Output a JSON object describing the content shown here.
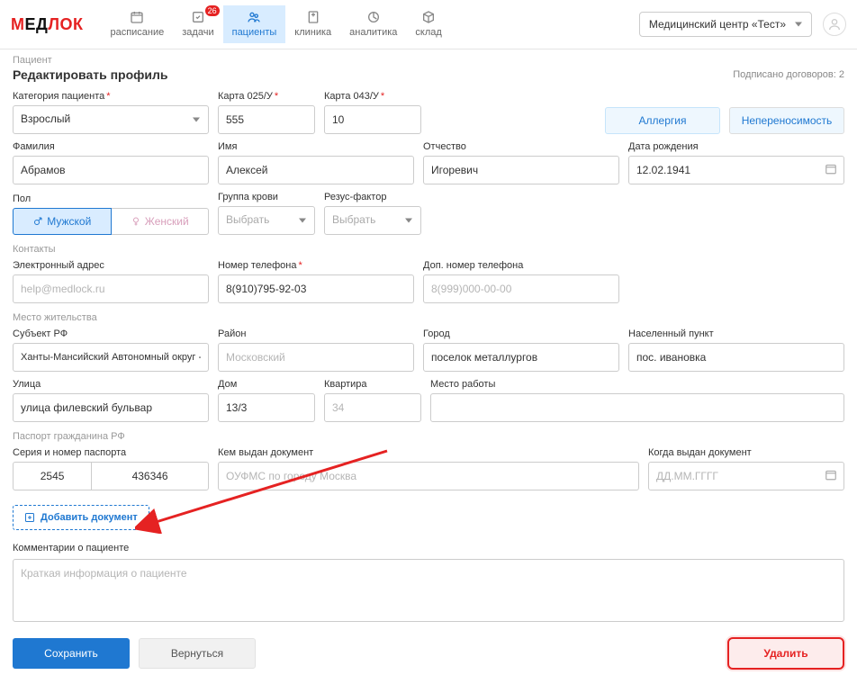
{
  "header": {
    "logo": {
      "part1": "M",
      "part2": "ЕД",
      "part3": "ЛОК"
    },
    "nav": [
      {
        "label": "расписание",
        "icon": "calendar",
        "badge": null
      },
      {
        "label": "задачи",
        "icon": "tasks",
        "badge": "26"
      },
      {
        "label": "пациенты",
        "icon": "patients",
        "badge": null,
        "active": true
      },
      {
        "label": "клиника",
        "icon": "clinic",
        "badge": null
      },
      {
        "label": "аналитика",
        "icon": "analytics",
        "badge": null
      },
      {
        "label": "склад",
        "icon": "warehouse",
        "badge": null
      }
    ],
    "center": "Медицинский центр «Тест»"
  },
  "breadcrumb": "Пациент",
  "title": "Редактировать профиль",
  "signed": "Подписано договоров: 2",
  "buttons": {
    "allergy": "Аллергия",
    "intolerance": "Непереносимость",
    "add_doc": "Добавить документ",
    "save": "Сохранить",
    "back": "Вернуться",
    "delete": "Удалить"
  },
  "labels": {
    "category": "Категория пациента",
    "card025": "Карта 025/У",
    "card043": "Карта 043/У",
    "lastname": "Фамилия",
    "firstname": "Имя",
    "patronymic": "Отчество",
    "birthdate": "Дата рождения",
    "gender": "Пол",
    "blood": "Группа крови",
    "rh": "Резус-фактор",
    "contacts": "Контакты",
    "email": "Электронный адрес",
    "phone": "Номер телефона",
    "phone2": "Доп. номер телефона",
    "residence": "Место жительства",
    "region": "Субъект РФ",
    "district": "Район",
    "city": "Город",
    "settlement": "Населенный пункт",
    "street": "Улица",
    "house": "Дом",
    "apt": "Квартира",
    "work": "Место работы",
    "passport_section": "Паспорт гражданина РФ",
    "passport_sn": "Серия и номер паспорта",
    "passport_issuer": "Кем выдан документ",
    "passport_date": "Когда выдан документ",
    "comments": "Комментарии о пациенте"
  },
  "values": {
    "category": "Взрослый",
    "card025": "555",
    "card043": "10",
    "lastname": "Абрамов",
    "firstname": "Алексей",
    "patronymic": "Игоревич",
    "birthdate": "12.02.1941",
    "gender_male": "Мужской",
    "gender_female": "Женский",
    "blood": "Выбрать",
    "rh": "Выбрать",
    "email_ph": "help@medlock.ru",
    "phone": "8(910)795-92-03",
    "phone2_ph": "8(999)000-00-00",
    "region": "Ханты-Мансийский Автономный округ - Югра",
    "district_ph": "Московский",
    "city": "поселок металлургов",
    "settlement": "пос. ивановка",
    "street": "улица филевский бульвар",
    "house": "13/3",
    "apt_ph": "34",
    "passport_series": "2545",
    "passport_number": "436346",
    "passport_issuer_ph": "ОУФМС по городу Москва",
    "passport_date_ph": "ДД.ММ.ГГГГ",
    "comments_ph": "Краткая информация о пациенте"
  }
}
